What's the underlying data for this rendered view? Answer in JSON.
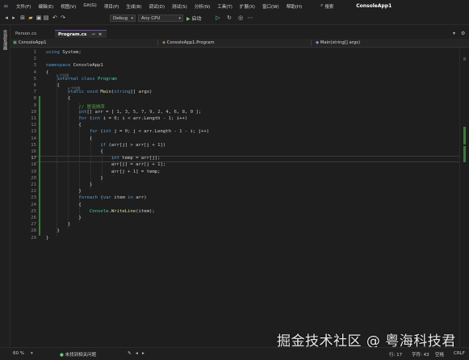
{
  "menu": {
    "items": [
      "文件(F)",
      "编辑(E)",
      "视图(V)",
      "Git(G)",
      "项目(P)",
      "生成(B)",
      "调试(D)",
      "测试(S)",
      "分析(N)",
      "工具(T)",
      "扩展(X)",
      "窗口(W)",
      "帮助(H)"
    ],
    "search_label": "搜索",
    "app_title": "ConsoleApp1"
  },
  "toolbar": {
    "config": "Debug",
    "platform": "Any CPU",
    "start_label": "启动"
  },
  "left_strip": {
    "label": "资源管理器"
  },
  "tabs": [
    {
      "label": "Person.cs",
      "active": false
    },
    {
      "label": "Program.cs",
      "active": true
    }
  ],
  "navbar": {
    "project": "ConsoleApp1",
    "class": "ConsoleApp1.Program",
    "member": "Main(string[] args)"
  },
  "editor": {
    "refs_label": "0 个引用",
    "current_line": 17,
    "lines": [
      {
        "n": 1,
        "html": "<span class='kw'>using</span> System;"
      },
      {
        "n": 2,
        "html": ""
      },
      {
        "n": 3,
        "html": "<span class='kw'>namespace</span> ConsoleApp1"
      },
      {
        "n": 4,
        "html": "{"
      },
      {
        "n": 5,
        "html": "    <span class='kw'>internal</span> <span class='kw'>class</span> <span class='ty'>Program</span>"
      },
      {
        "n": 6,
        "html": "    {"
      },
      {
        "n": 7,
        "html": "        <span class='kw'>static</span> <span class='kw'>void</span> <span class='mt'>Main</span>(<span class='kw'>string</span>[] args)"
      },
      {
        "n": 8,
        "html": "        {"
      },
      {
        "n": 9,
        "html": "            <span class='cm'>// 冒泡排序</span>"
      },
      {
        "n": 10,
        "html": "            <span class='kw'>int</span>[] arr = [ <span class='num'>1</span>, <span class='num'>3</span>, <span class='num'>5</span>, <span class='num'>7</span>, <span class='num'>9</span>, <span class='num'>2</span>, <span class='num'>4</span>, <span class='num'>6</span>, <span class='num'>8</span>, <span class='num'>0</span> ];"
      },
      {
        "n": 11,
        "html": "            <span class='kw'>for</span> (<span class='kw'>int</span> i = <span class='num'>0</span>; i &lt; arr.Length - <span class='num'>1</span>; i++)"
      },
      {
        "n": 12,
        "html": "            {"
      },
      {
        "n": 13,
        "html": "                <span class='kw'>for</span> (<span class='kw'>int</span> j = <span class='num'>0</span>; j &lt; arr.Length - <span class='num'>1</span> - i; j++)"
      },
      {
        "n": 14,
        "html": "                {"
      },
      {
        "n": 15,
        "html": "                    <span class='kw'>if</span> (arr[j] &gt; arr[j + <span class='num'>1</span>])"
      },
      {
        "n": 16,
        "html": "                    {"
      },
      {
        "n": 17,
        "html": "                        <span class='kw'>int</span> temp = arr[j];"
      },
      {
        "n": 18,
        "html": "                        arr[j] = arr[j + <span class='num'>1</span>];"
      },
      {
        "n": 19,
        "html": "                        arr[j + <span class='num'>1</span>] = temp;"
      },
      {
        "n": 20,
        "html": "                    }"
      },
      {
        "n": 21,
        "html": "                }"
      },
      {
        "n": 22,
        "html": "            }"
      },
      {
        "n": 23,
        "html": "            <span class='kw'>foreach</span> (<span class='kw'>var</span> item <span class='kw'>in</span> arr)"
      },
      {
        "n": 24,
        "html": "            {"
      },
      {
        "n": 25,
        "html": "                <span class='ty'>Console</span>.<span class='mt'>WriteLine</span>(item);"
      },
      {
        "n": 26,
        "html": "            }"
      },
      {
        "n": 27,
        "html": "        }"
      },
      {
        "n": 28,
        "html": "    }"
      },
      {
        "n": 29,
        "html": "}"
      }
    ]
  },
  "statusbar": {
    "zoom": "60 %",
    "issues": "未找到相关问题",
    "line": "行: 17",
    "char": "字符: 43",
    "space": "空格",
    "eol": "CRLF"
  },
  "watermark": "掘金技术社区 @ 粤海科技君",
  "colors": {
    "keyword": "#569cd6",
    "type": "#4ec9b0",
    "comment": "#57a64a",
    "number": "#b5cea8",
    "method": "#dcdcaa"
  }
}
